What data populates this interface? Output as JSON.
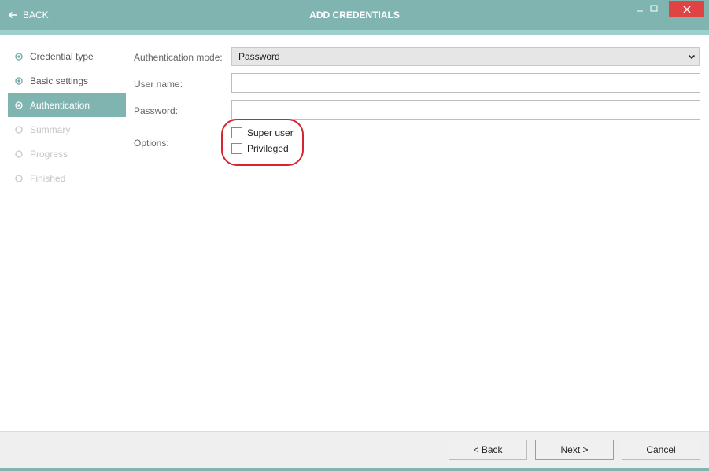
{
  "window": {
    "title": "ADD CREDENTIALS",
    "back_label": "BACK"
  },
  "colors": {
    "accent": "#7fb4b1",
    "close": "#e04343",
    "highlight": "#d6252f"
  },
  "steps": [
    {
      "label": "Credential type",
      "state": "done"
    },
    {
      "label": "Basic settings",
      "state": "done"
    },
    {
      "label": "Authentication",
      "state": "active"
    },
    {
      "label": "Summary",
      "state": "pending"
    },
    {
      "label": "Progress",
      "state": "pending"
    },
    {
      "label": "Finished",
      "state": "pending"
    }
  ],
  "form": {
    "auth_mode_label": "Authentication mode:",
    "auth_mode_value": "Password",
    "username_label": "User name:",
    "username_value": "",
    "password_label": "Password:",
    "password_value": "",
    "options_label": "Options:",
    "options": [
      {
        "label": "Super user",
        "checked": false
      },
      {
        "label": "Privileged",
        "checked": false
      }
    ]
  },
  "footer": {
    "back": "< Back",
    "next": "Next >",
    "cancel": "Cancel"
  }
}
